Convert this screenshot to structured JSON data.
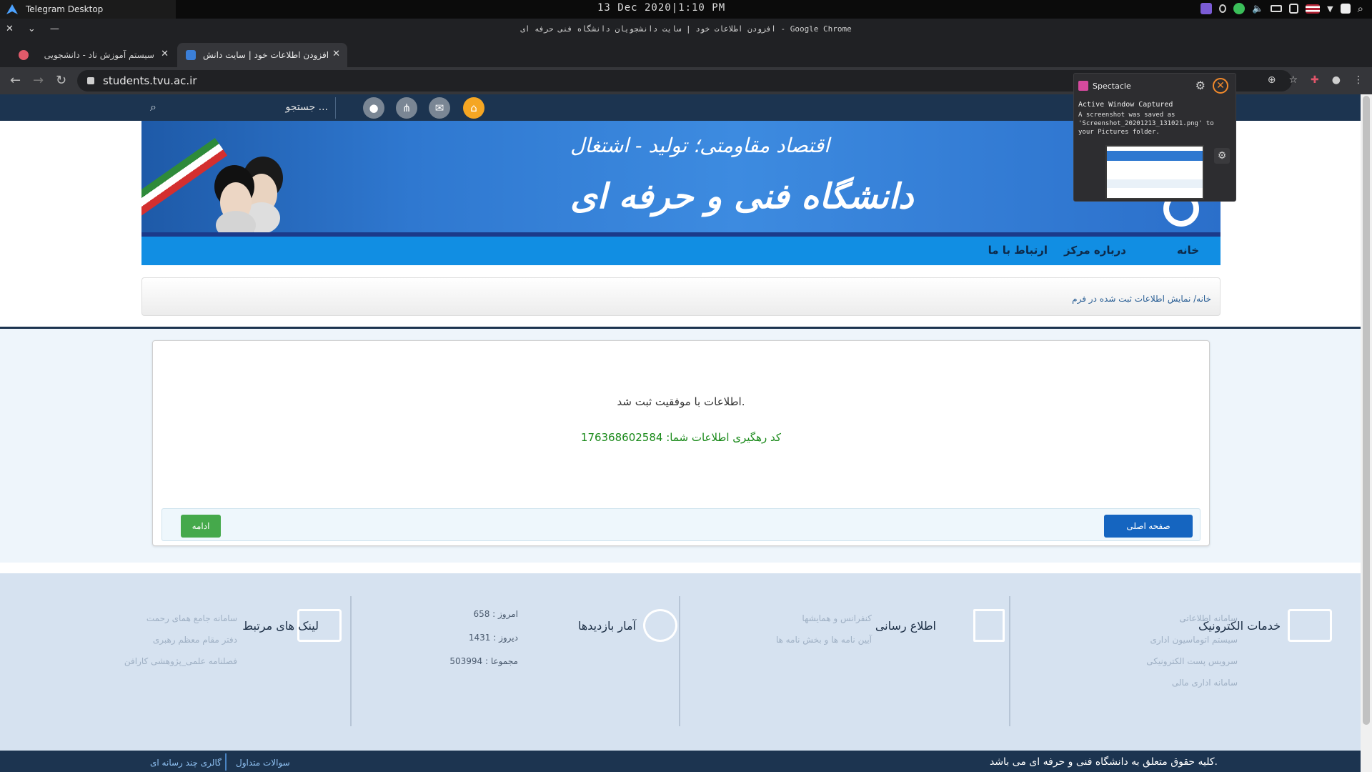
{
  "system": {
    "app_title": "Telegram Desktop",
    "clock": "13 Dec 2020|1:10 PM"
  },
  "browser": {
    "window_title": "افزودن اطلاعات خود | سایت دانشجویان دانشگاه فنی حرفه ای - Google Chrome",
    "tabs": [
      {
        "title": "سیستم آموزش ناد - دانشجویی"
      },
      {
        "title": "افزودن اطلاعات خود | سایت دانش"
      }
    ],
    "url": "students.tvu.ac.ir"
  },
  "site": {
    "search_placeholder": "جستجو ...",
    "banner": {
      "slogan": "اقتصاد مقاومتی؛ تولید - اشتغال",
      "university": "دانشگاه فنی و حرفه ای"
    },
    "nav": [
      {
        "label": "خانه"
      },
      {
        "label": "درباره مرکز"
      },
      {
        "label": "ارتباط با ما"
      }
    ],
    "breadcrumb": "خانه/ نمایش اطلاعات ثبت شده در فرم",
    "result": {
      "message": "اطلاعات با موفقیت ثبت شد.",
      "tracking": "کد رهگیری اطلاعات شما: 176368602584"
    },
    "buttons": {
      "home": "صفحه اصلی",
      "continue": "ادامه"
    },
    "footer": {
      "services": {
        "title": "خدمات الکترونیک",
        "links": [
          "سامانه اطلاعاتی",
          "سیستم اتوماسیون اداری",
          "سرویس پست الکترونیکی",
          "سامانه اداری مالی"
        ]
      },
      "info": {
        "title": "اطلاع رسانی",
        "links": [
          "کنفرانس و همایشها",
          "آیین نامه ها و بخش نامه ها"
        ]
      },
      "stats": {
        "title": "آمار بازدیدها",
        "rows": [
          "امروز : 658",
          "دیروز : 1431",
          "مجموعا : 503994"
        ]
      },
      "links": {
        "title": "لینک های مرتبط",
        "items": [
          "سامانه جامع همای رحمت",
          "دفتر مقام معظم رهبری",
          "فصلنامه علمی_پژوهشی کارافن"
        ]
      }
    },
    "bottom": {
      "copyright": "کلیه حقوق متعلق به دانشگاه فنی و حرفه ای می باشد.",
      "faq": "سوالات متداول",
      "gallery": "گالری چند رسانه ای"
    }
  },
  "notification": {
    "app": "Spectacle",
    "title": "Active Window Captured",
    "body": "A screenshot was saved as 'Screenshot_20201213_131021.png' to your Pictures folder."
  }
}
